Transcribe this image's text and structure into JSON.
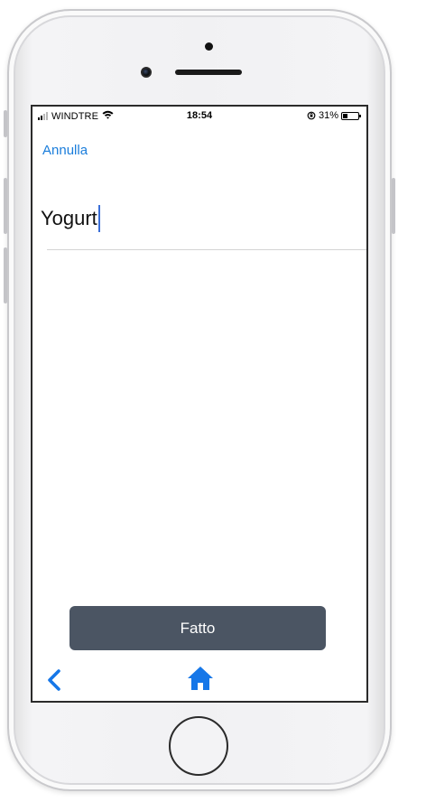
{
  "status_bar": {
    "carrier": "WINDTRE",
    "time": "18:54",
    "battery_percent_label": "31%",
    "battery_level": 0.31,
    "signal_bars": 2,
    "icons": [
      "signal-icon",
      "wifi-icon",
      "orientation-lock-icon",
      "battery-icon"
    ]
  },
  "header": {
    "cancel_label": "Annulla"
  },
  "form": {
    "item_value": "Yogurt"
  },
  "footer": {
    "done_label": "Fatto"
  },
  "nav": {
    "back_icon": "chevron-left-icon",
    "home_icon": "home-icon"
  },
  "colors": {
    "accent": "#1a7ddb",
    "button_bg": "#4b5563",
    "nav_icon": "#1677e8",
    "caret": "#3b6fd8"
  }
}
